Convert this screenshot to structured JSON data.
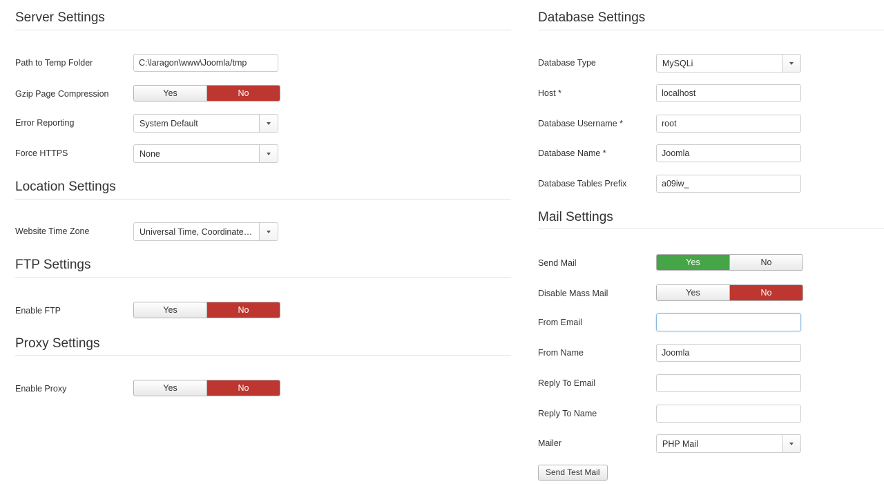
{
  "server": {
    "title": "Server Settings",
    "temp_path": {
      "label": "Path to Temp Folder",
      "value": "C:\\laragon\\www\\Joomla/tmp"
    },
    "gzip": {
      "label": "Gzip Page Compression",
      "yes": "Yes",
      "no": "No",
      "selected": "No"
    },
    "error_reporting": {
      "label": "Error Reporting",
      "value": "System Default"
    },
    "force_https": {
      "label": "Force HTTPS",
      "value": "None"
    }
  },
  "location": {
    "title": "Location Settings",
    "timezone": {
      "label": "Website Time Zone",
      "value": "Universal Time, Coordinated (UTC)"
    }
  },
  "ftp": {
    "title": "FTP Settings",
    "enable": {
      "label": "Enable FTP",
      "yes": "Yes",
      "no": "No",
      "selected": "No"
    }
  },
  "proxy": {
    "title": "Proxy Settings",
    "enable": {
      "label": "Enable Proxy",
      "yes": "Yes",
      "no": "No",
      "selected": "No"
    }
  },
  "database": {
    "title": "Database Settings",
    "type": {
      "label": "Database Type",
      "value": "MySQLi"
    },
    "host": {
      "label": "Host *",
      "value": "localhost"
    },
    "username": {
      "label": "Database Username *",
      "value": "root"
    },
    "name": {
      "label": "Database Name *",
      "value": "Joomla"
    },
    "prefix": {
      "label": "Database Tables Prefix",
      "value": "a09iw_"
    }
  },
  "mail": {
    "title": "Mail Settings",
    "send_mail": {
      "label": "Send Mail",
      "yes": "Yes",
      "no": "No",
      "selected": "Yes"
    },
    "mass_mail": {
      "label": "Disable Mass Mail",
      "yes": "Yes",
      "no": "No",
      "selected": "No"
    },
    "from_email": {
      "label": "From Email",
      "value": ""
    },
    "from_name": {
      "label": "From Name",
      "value": "Joomla"
    },
    "reply_email": {
      "label": "Reply To Email",
      "value": ""
    },
    "reply_name": {
      "label": "Reply To Name",
      "value": ""
    },
    "mailer": {
      "label": "Mailer",
      "value": "PHP Mail"
    },
    "test_button": "Send Test Mail"
  },
  "colors": {
    "toggle_no_active": "#bd362f",
    "toggle_yes_active": "#46a546",
    "rule": "#e3e3e3"
  }
}
